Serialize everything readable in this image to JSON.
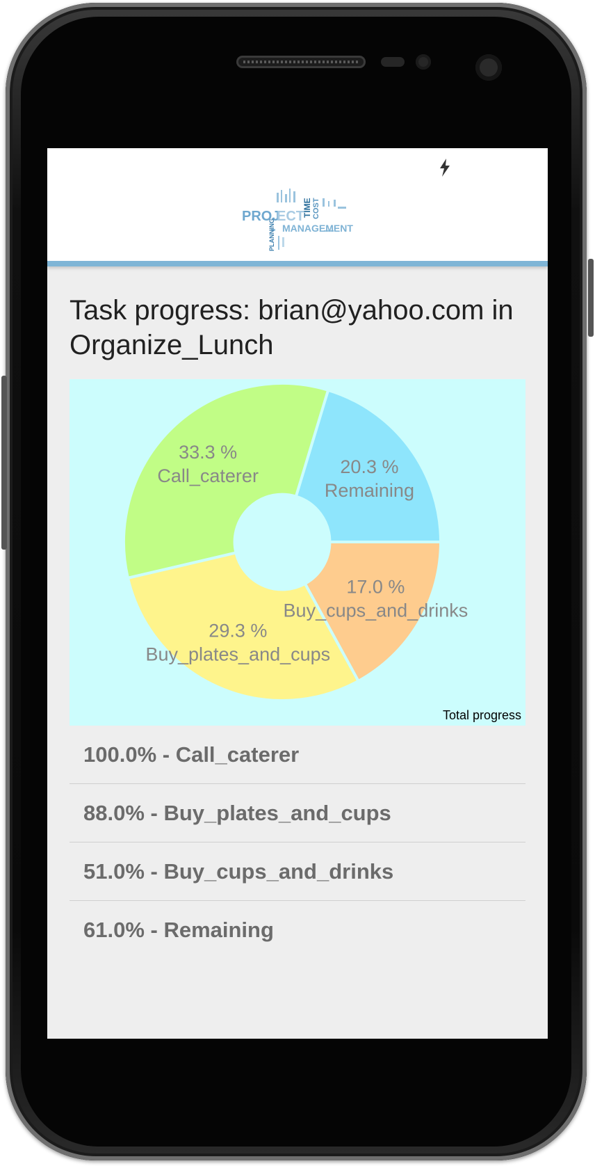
{
  "app": {
    "logo_text": "PROJECT MANAGEMENT",
    "status_icon": "flash-icon"
  },
  "page": {
    "title": "Task progress: brian@yahoo.com in Organize_Lunch"
  },
  "chart_data": {
    "type": "pie",
    "description": "Total progress",
    "hole_ratio": 0.3,
    "slices": [
      {
        "label": "Remaining",
        "value": 20.3,
        "display": "20.3 %",
        "color": "#8ee5fc"
      },
      {
        "label": "Call_caterer",
        "value": 33.3,
        "display": "33.3 %",
        "color": "#c1fd86"
      },
      {
        "label": "Buy_plates_and_cups",
        "value": 29.3,
        "display": "29.3 %",
        "color": "#fef48c"
      },
      {
        "label": "Buy_cups_and_drinks",
        "value": 17.0,
        "display": "17.0 %",
        "color": "#fecc8e"
      }
    ],
    "label_color": "#888888"
  },
  "tasks": [
    {
      "text": "100.0% - Call_caterer"
    },
    {
      "text": "88.0% - Buy_plates_and_cups"
    },
    {
      "text": "51.0% - Buy_cups_and_drinks"
    },
    {
      "text": "61.0% - Remaining"
    }
  ]
}
